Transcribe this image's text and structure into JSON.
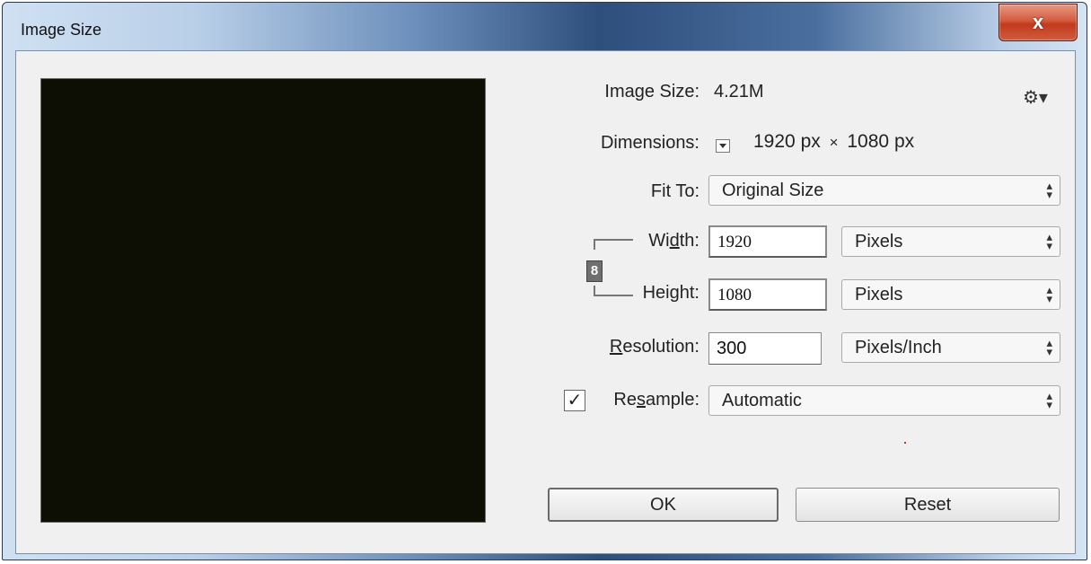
{
  "window": {
    "title": "Image Size",
    "close_glyph": "x"
  },
  "info": {
    "image_size_label": "Image Size:",
    "image_size_value": "4.21M",
    "dimensions_label": "Dimensions:",
    "dim_width": "1920",
    "dim_width_unit": "px",
    "dim_times": "×",
    "dim_height": "1080",
    "dim_height_unit": "px",
    "gear_glyph": "⚙▾"
  },
  "fit_to": {
    "label": "Fit To:",
    "value": "Original Size"
  },
  "width": {
    "label_pre": "Wi",
    "label_u": "d",
    "label_post": "th:",
    "value": "1920",
    "unit": "Pixels"
  },
  "height": {
    "label_pre": "Hei",
    "label_u": "g",
    "label_post": "ht:",
    "value": "1080",
    "unit": "Pixels"
  },
  "resolution": {
    "label_u": "R",
    "label_post": "esolution:",
    "value": "300",
    "unit": "Pixels/Inch"
  },
  "resample": {
    "checked": true,
    "check_glyph": "✓",
    "label_pre": "Re",
    "label_u": "s",
    "label_post": "ample:",
    "value": "Automatic"
  },
  "buttons": {
    "ok": "OK",
    "reset": "Reset"
  },
  "icons": {
    "chain": "link-icon",
    "gear": "gear-icon",
    "close": "close-icon",
    "select_arrow": "updown-arrow-icon"
  },
  "colors": {
    "preview_bg": "#0d0f04",
    "dialog_bg": "#f0f0f0",
    "close_red": "#c23a1c"
  }
}
